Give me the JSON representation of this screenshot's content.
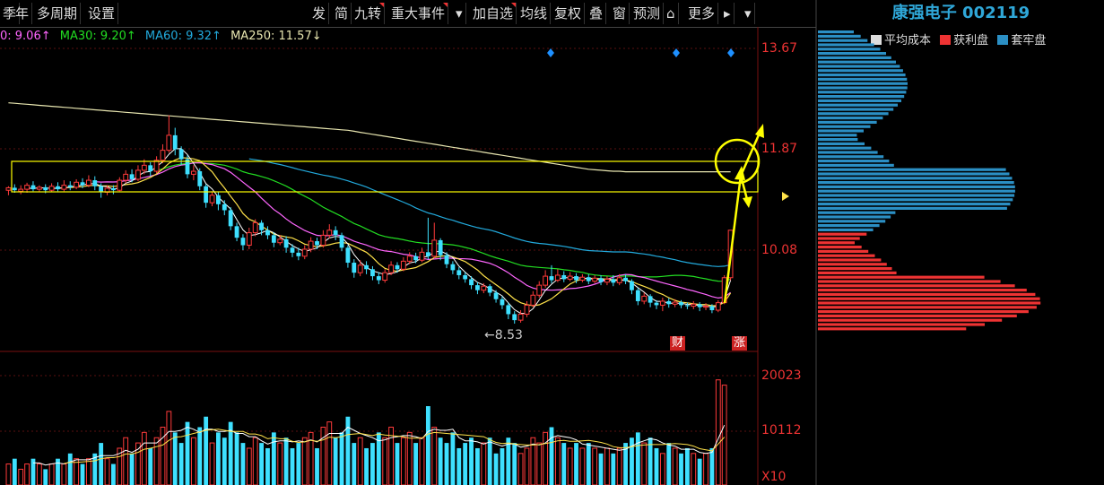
{
  "toolbar": {
    "left_items": [
      "季",
      "年",
      "多周期",
      "设置"
    ],
    "right_items": [
      "发",
      "简",
      "九转",
      "重大事件",
      "▾",
      "加自选",
      "均线",
      "复权",
      "叠",
      "窗",
      "预测",
      "⌂",
      "更多",
      "▸",
      "▾"
    ]
  },
  "stock": {
    "title": "康强电子 002119"
  },
  "ma_legend": {
    "ma20": "0: 9.06↑",
    "ma30": "MA30: 9.20↑",
    "ma60": "MA60: 9.32↑",
    "ma250": "MA250: 11.57↓"
  },
  "chip_legend": {
    "avg_cost": "平均成本",
    "profit": "获利盘",
    "trapped": "套牢盘"
  },
  "colors": {
    "up": "#ff3b3b",
    "down": "#3ee0ff",
    "ma_short": "#ffffff",
    "ma10": "#ffe24a",
    "ma20": "#ff66ff",
    "ma30": "#22dd22",
    "ma60": "#22aadd",
    "ma250": "#e8e6b0",
    "annotation": "#ffff00"
  },
  "chart_data": {
    "type": "candlestick",
    "price_ticks": [
      "13.67",
      "11.87",
      "10.08"
    ],
    "volume_ticks": [
      "20023",
      "10112",
      "X10"
    ],
    "low_marker": "8.53",
    "event_tags": [
      "财",
      "涨"
    ],
    "ylim": [
      8.1,
      14.2
    ],
    "candles": [
      [
        11.2,
        11.25,
        11.28,
        11.1
      ],
      [
        11.25,
        11.2,
        11.32,
        11.15
      ],
      [
        11.18,
        11.22,
        11.3,
        11.12
      ],
      [
        11.22,
        11.3,
        11.35,
        11.15
      ],
      [
        11.3,
        11.22,
        11.38,
        11.18
      ],
      [
        11.22,
        11.26,
        11.3,
        11.16
      ],
      [
        11.26,
        11.2,
        11.32,
        11.14
      ],
      [
        11.2,
        11.28,
        11.34,
        11.16
      ],
      [
        11.28,
        11.22,
        11.36,
        11.18
      ],
      [
        11.22,
        11.3,
        11.4,
        11.18
      ],
      [
        11.3,
        11.26,
        11.38,
        11.2
      ],
      [
        11.26,
        11.36,
        11.42,
        11.22
      ],
      [
        11.36,
        11.3,
        11.44,
        11.24
      ],
      [
        11.3,
        11.4,
        11.5,
        11.26
      ],
      [
        11.4,
        11.28,
        11.48,
        11.2
      ],
      [
        11.28,
        11.16,
        11.34,
        11.05
      ],
      [
        11.16,
        11.24,
        11.3,
        11.1
      ],
      [
        11.24,
        11.2,
        11.3,
        11.12
      ],
      [
        11.2,
        11.4,
        11.46,
        11.18
      ],
      [
        11.4,
        11.52,
        11.6,
        11.34
      ],
      [
        11.52,
        11.42,
        11.62,
        11.36
      ],
      [
        11.42,
        11.6,
        11.7,
        11.38
      ],
      [
        11.6,
        11.7,
        11.82,
        11.52
      ],
      [
        11.7,
        11.58,
        11.76,
        11.48
      ],
      [
        11.58,
        11.8,
        11.88,
        11.54
      ],
      [
        11.8,
        12.0,
        12.12,
        11.74
      ],
      [
        12.0,
        12.3,
        12.7,
        11.95
      ],
      [
        12.3,
        12.02,
        12.45,
        11.9
      ],
      [
        12.02,
        11.82,
        12.08,
        11.7
      ],
      [
        11.82,
        11.52,
        11.9,
        11.44
      ],
      [
        11.52,
        11.58,
        11.7,
        11.4
      ],
      [
        11.58,
        11.28,
        11.64,
        11.2
      ],
      [
        11.28,
        10.95,
        11.32,
        10.85
      ],
      [
        10.95,
        11.1,
        11.18,
        10.88
      ],
      [
        11.1,
        10.92,
        11.16,
        10.8
      ],
      [
        10.92,
        10.8,
        11.0,
        10.7
      ],
      [
        10.8,
        10.48,
        10.86,
        10.4
      ],
      [
        10.48,
        10.25,
        10.55,
        10.18
      ],
      [
        10.25,
        10.1,
        10.32,
        10.0
      ],
      [
        10.1,
        10.35,
        10.45,
        10.02
      ],
      [
        10.35,
        10.55,
        10.62,
        10.28
      ],
      [
        10.55,
        10.4,
        10.6,
        10.3
      ],
      [
        10.4,
        10.3,
        10.48,
        10.22
      ],
      [
        10.3,
        10.15,
        10.36,
        10.06
      ],
      [
        10.15,
        10.22,
        10.3,
        10.1
      ],
      [
        10.22,
        10.05,
        10.28,
        9.95
      ],
      [
        10.05,
        9.95,
        10.12,
        9.86
      ],
      [
        9.95,
        9.88,
        10.05,
        9.8
      ],
      [
        9.88,
        10.02,
        10.1,
        9.82
      ],
      [
        10.02,
        10.18,
        10.26,
        9.96
      ],
      [
        10.18,
        10.1,
        10.25,
        10.02
      ],
      [
        10.1,
        10.3,
        10.4,
        10.05
      ],
      [
        10.3,
        10.4,
        10.52,
        10.24
      ],
      [
        10.4,
        10.3,
        10.48,
        10.2
      ],
      [
        10.3,
        10.05,
        10.35,
        9.98
      ],
      [
        10.05,
        9.75,
        10.1,
        9.65
      ],
      [
        9.75,
        9.55,
        9.82,
        9.45
      ],
      [
        9.55,
        9.7,
        9.8,
        9.48
      ],
      [
        9.7,
        9.62,
        9.78,
        9.52
      ],
      [
        9.62,
        9.48,
        9.68,
        9.4
      ],
      [
        9.48,
        9.4,
        9.56,
        9.32
      ],
      [
        9.4,
        9.55,
        9.62,
        9.35
      ],
      [
        9.55,
        9.7,
        9.78,
        9.5
      ],
      [
        9.7,
        9.62,
        9.76,
        9.55
      ],
      [
        9.62,
        9.78,
        9.86,
        9.58
      ],
      [
        9.78,
        9.88,
        9.96,
        9.72
      ],
      [
        9.88,
        9.8,
        9.95,
        9.74
      ],
      [
        9.8,
        9.96,
        10.05,
        9.76
      ],
      [
        9.96,
        9.88,
        10.65,
        9.82
      ],
      [
        9.88,
        10.2,
        10.55,
        9.84
      ],
      [
        10.2,
        9.9,
        10.24,
        9.8
      ],
      [
        9.9,
        9.72,
        9.96,
        9.64
      ],
      [
        9.72,
        9.6,
        9.78,
        9.52
      ],
      [
        9.6,
        9.5,
        9.66,
        9.42
      ],
      [
        9.5,
        9.42,
        9.56,
        9.35
      ],
      [
        9.42,
        9.3,
        9.48,
        9.22
      ],
      [
        9.3,
        9.2,
        9.36,
        9.12
      ],
      [
        9.2,
        9.28,
        9.34,
        9.14
      ],
      [
        9.28,
        9.15,
        9.32,
        9.08
      ],
      [
        9.15,
        9.02,
        9.2,
        8.95
      ],
      [
        9.02,
        8.9,
        9.08,
        8.82
      ],
      [
        8.9,
        8.72,
        8.95,
        8.62
      ],
      [
        8.72,
        8.6,
        8.78,
        8.53
      ],
      [
        8.6,
        8.72,
        8.8,
        8.55
      ],
      [
        8.72,
        8.9,
        8.98,
        8.66
      ],
      [
        8.9,
        9.1,
        9.18,
        8.86
      ],
      [
        9.1,
        9.3,
        9.38,
        9.05
      ],
      [
        9.3,
        9.48,
        9.6,
        9.25
      ],
      [
        9.48,
        9.4,
        9.7,
        9.34
      ],
      [
        9.4,
        9.5,
        9.62,
        9.36
      ],
      [
        9.5,
        9.42,
        9.58,
        9.36
      ],
      [
        9.42,
        9.48,
        9.56,
        9.38
      ],
      [
        9.48,
        9.4,
        9.54,
        9.34
      ],
      [
        9.4,
        9.46,
        9.52,
        9.36
      ],
      [
        9.46,
        9.38,
        9.52,
        9.32
      ],
      [
        9.38,
        9.44,
        9.5,
        9.34
      ],
      [
        9.44,
        9.36,
        9.5,
        9.3
      ],
      [
        9.36,
        9.42,
        9.48,
        9.3
      ],
      [
        9.42,
        9.35,
        9.5,
        9.28
      ],
      [
        9.35,
        9.45,
        9.52,
        9.3
      ],
      [
        9.45,
        9.38,
        9.52,
        9.32
      ],
      [
        9.38,
        9.2,
        9.42,
        9.12
      ],
      [
        9.2,
        8.98,
        9.25,
        8.9
      ],
      [
        8.98,
        9.08,
        9.15,
        8.92
      ],
      [
        9.08,
        8.95,
        9.12,
        8.86
      ],
      [
        8.95,
        8.9,
        9.0,
        8.82
      ],
      [
        8.9,
        8.98,
        9.05,
        8.78
      ],
      [
        8.98,
        8.92,
        9.04,
        8.85
      ],
      [
        8.92,
        8.96,
        9.02,
        8.86
      ],
      [
        8.96,
        8.9,
        9.0,
        8.84
      ],
      [
        8.9,
        8.88,
        8.95,
        8.82
      ],
      [
        8.88,
        8.92,
        8.98,
        8.82
      ],
      [
        8.92,
        8.86,
        8.96,
        8.78
      ],
      [
        8.86,
        8.88,
        8.94,
        8.8
      ],
      [
        8.88,
        8.8,
        8.92,
        8.74
      ],
      [
        8.8,
        8.95,
        9.0,
        8.76
      ],
      [
        8.95,
        9.45,
        9.5,
        8.92
      ],
      [
        9.45,
        10.4,
        10.4,
        9.4
      ]
    ],
    "ma250": [
      12.95,
      12.94,
      12.93,
      12.92,
      12.91,
      12.9,
      12.89,
      12.88,
      12.87,
      12.86,
      12.85,
      12.84,
      12.83,
      12.82,
      12.81,
      12.8,
      12.79,
      12.78,
      12.77,
      12.76,
      12.75,
      12.74,
      12.73,
      12.72,
      12.71,
      12.7,
      12.69,
      12.68,
      12.67,
      12.66,
      12.65,
      12.64,
      12.63,
      12.62,
      12.61,
      12.6,
      12.59,
      12.58,
      12.57,
      12.56,
      12.55,
      12.54,
      12.53,
      12.52,
      12.51,
      12.5,
      12.49,
      12.48,
      12.47,
      12.46,
      12.45,
      12.44,
      12.43,
      12.42,
      12.41,
      12.4,
      12.38,
      12.36,
      12.34,
      12.32,
      12.3,
      12.28,
      12.26,
      12.24,
      12.22,
      12.2,
      12.18,
      12.16,
      12.14,
      12.12,
      12.1,
      12.08,
      12.06,
      12.04,
      12.02,
      12.0,
      11.98,
      11.96,
      11.94,
      11.92,
      11.9,
      11.88,
      11.86,
      11.84,
      11.82,
      11.8,
      11.78,
      11.76,
      11.74,
      11.72,
      11.7,
      11.68,
      11.66,
      11.64,
      11.62,
      11.61,
      11.6,
      11.59,
      11.58,
      11.58,
      11.57,
      11.57,
      11.57,
      11.57,
      11.57,
      11.57,
      11.57,
      11.57,
      11.57,
      11.57,
      11.57,
      11.57,
      11.57,
      11.57,
      11.57,
      11.57,
      11.57,
      11.57
    ],
    "volume": [
      4,
      5,
      3,
      4,
      5,
      4,
      3,
      4,
      5,
      4,
      6,
      5,
      4,
      5,
      6,
      8,
      5,
      4,
      7,
      9,
      6,
      8,
      10,
      7,
      9,
      11,
      14,
      10,
      8,
      12,
      9,
      11,
      13,
      8,
      10,
      9,
      12,
      10,
      8,
      7,
      9,
      8,
      7,
      10,
      8,
      9,
      7,
      8,
      9,
      10,
      7,
      11,
      12,
      9,
      10,
      13,
      8,
      9,
      7,
      8,
      10,
      9,
      11,
      8,
      9,
      10,
      8,
      9,
      15,
      11,
      9,
      8,
      10,
      7,
      8,
      9,
      7,
      8,
      9,
      6,
      7,
      9,
      8,
      6,
      7,
      9,
      8,
      10,
      11,
      9,
      8,
      7,
      8,
      7,
      8,
      7,
      6,
      7,
      6,
      7,
      8,
      9,
      10,
      8,
      9,
      7,
      6,
      8,
      7,
      6,
      7,
      6,
      5,
      6,
      7,
      20,
      19
    ],
    "chip_rows": 70
  }
}
